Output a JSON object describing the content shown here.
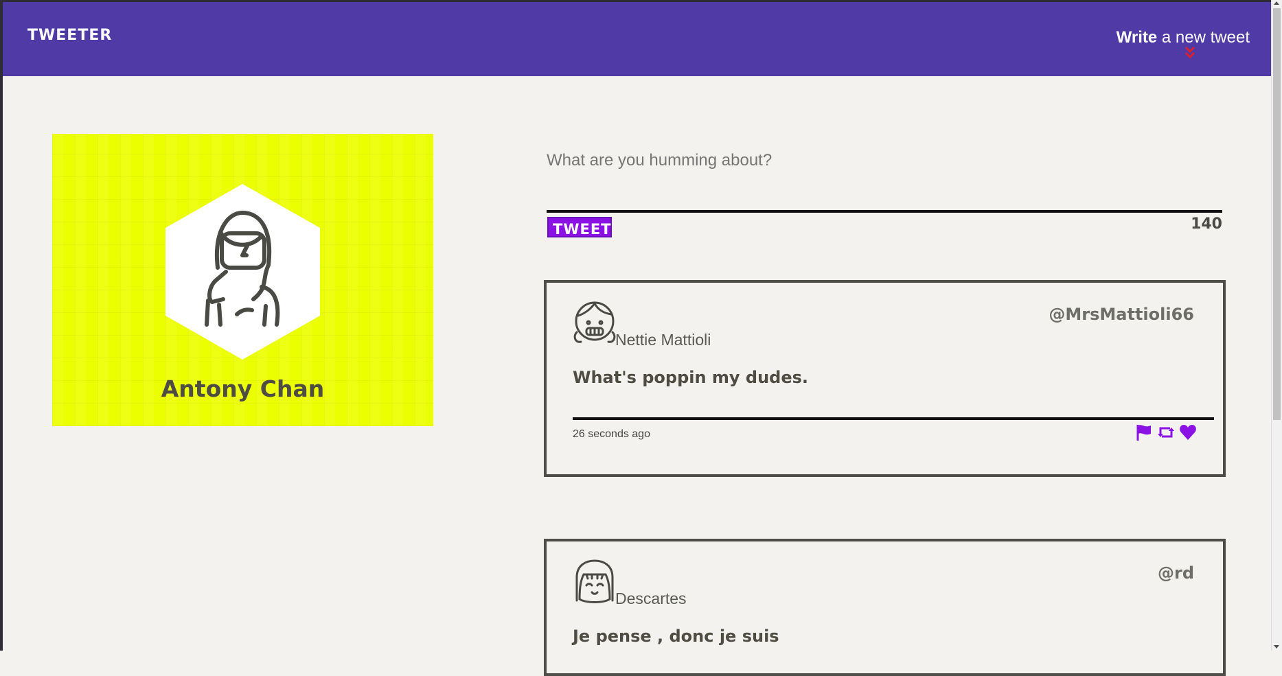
{
  "nav": {
    "brand": "TWEETER",
    "compose_bold": "Write",
    "compose_rest": " a new tweet"
  },
  "profile": {
    "name": "Antony Chan"
  },
  "composer": {
    "placeholder": "What are you humming about?",
    "button_label": "TWEET",
    "counter": "140"
  },
  "tweets": [
    {
      "name": "Nettie Mattioli",
      "handle": "@MrsMattioli66",
      "text": "What's poppin my dudes.",
      "time": "26 seconds ago"
    },
    {
      "name": "Descartes",
      "handle": "@rd",
      "text": "Je pense , donc je suis"
    }
  ],
  "colors": {
    "nav_bg": "#4f3aa6",
    "accent": "#8a12e3",
    "profile_bg": "#ecff00"
  }
}
